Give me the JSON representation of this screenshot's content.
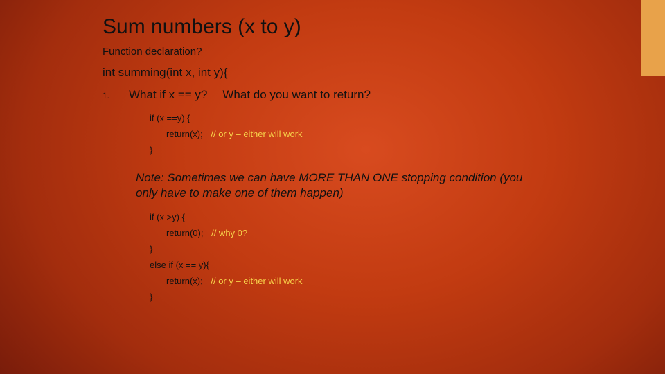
{
  "title": "Sum numbers (x to y)",
  "subtitle": "Function declaration?",
  "declaration": "int summing(int x, int y){",
  "list_number": "1.",
  "question1": "What if x == y?",
  "question2": "What do you want to return?",
  "block1": {
    "if_line": "if (x ==y) {",
    "ret": "return(x);",
    "ret_comment": "// or y – either will work",
    "close": "}"
  },
  "note": "Note: Sometimes we can have MORE THAN ONE stopping condition (you only have to make one of them happen)",
  "block2": {
    "if_line": "if (x >y) {",
    "ret": "return(0);",
    "ret_comment": "// why 0?",
    "close": "}",
    "elseif": "else if (x == y){",
    "ret2": "return(x);",
    "ret2_comment": "// or y – either will work",
    "close2": "}"
  }
}
